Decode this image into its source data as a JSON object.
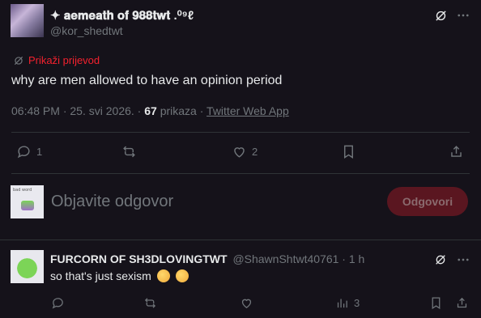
{
  "post": {
    "display_name": "✦ 𝐚𝐞𝐦𝐞𝐚𝐭𝐡 𝐨𝐟 𝟗𝟖𝟖𝐭𝐰𝐭 .⁰⁹ℓ",
    "handle": "@kor_shedtwt",
    "translate_label": "Prikaži prijevod",
    "text": "why are men allowed to have an opinion period",
    "time": "06:48 PM",
    "date": "25. svi 2026.",
    "views_count": "67",
    "views_label": "prikaza",
    "source": "Twitter Web App",
    "actions": {
      "reply_count": "1",
      "retweet_count": "",
      "like_count": "2"
    }
  },
  "composer": {
    "placeholder": "Objavite odgovor",
    "submit_label": "Odgovori",
    "avatar_caption": "bad word"
  },
  "reply": {
    "display_name": "FURCORN OF SH3DLOVINGTWT",
    "handle": "@ShawnShtwt40761",
    "separator": "·",
    "time_ago": "1 h",
    "text": "so that's just sexism",
    "actions": {
      "views_count": "3"
    }
  },
  "colors": {
    "background": "#15121a",
    "divider": "#2f3336",
    "muted": "#71767b",
    "translate": "#f4212e",
    "submit_bg": "#5a1620"
  },
  "icons": [
    "grok-icon",
    "more-icon",
    "translate-icon",
    "reply-icon",
    "retweet-icon",
    "like-icon",
    "bookmark-icon",
    "share-icon",
    "views-icon"
  ]
}
